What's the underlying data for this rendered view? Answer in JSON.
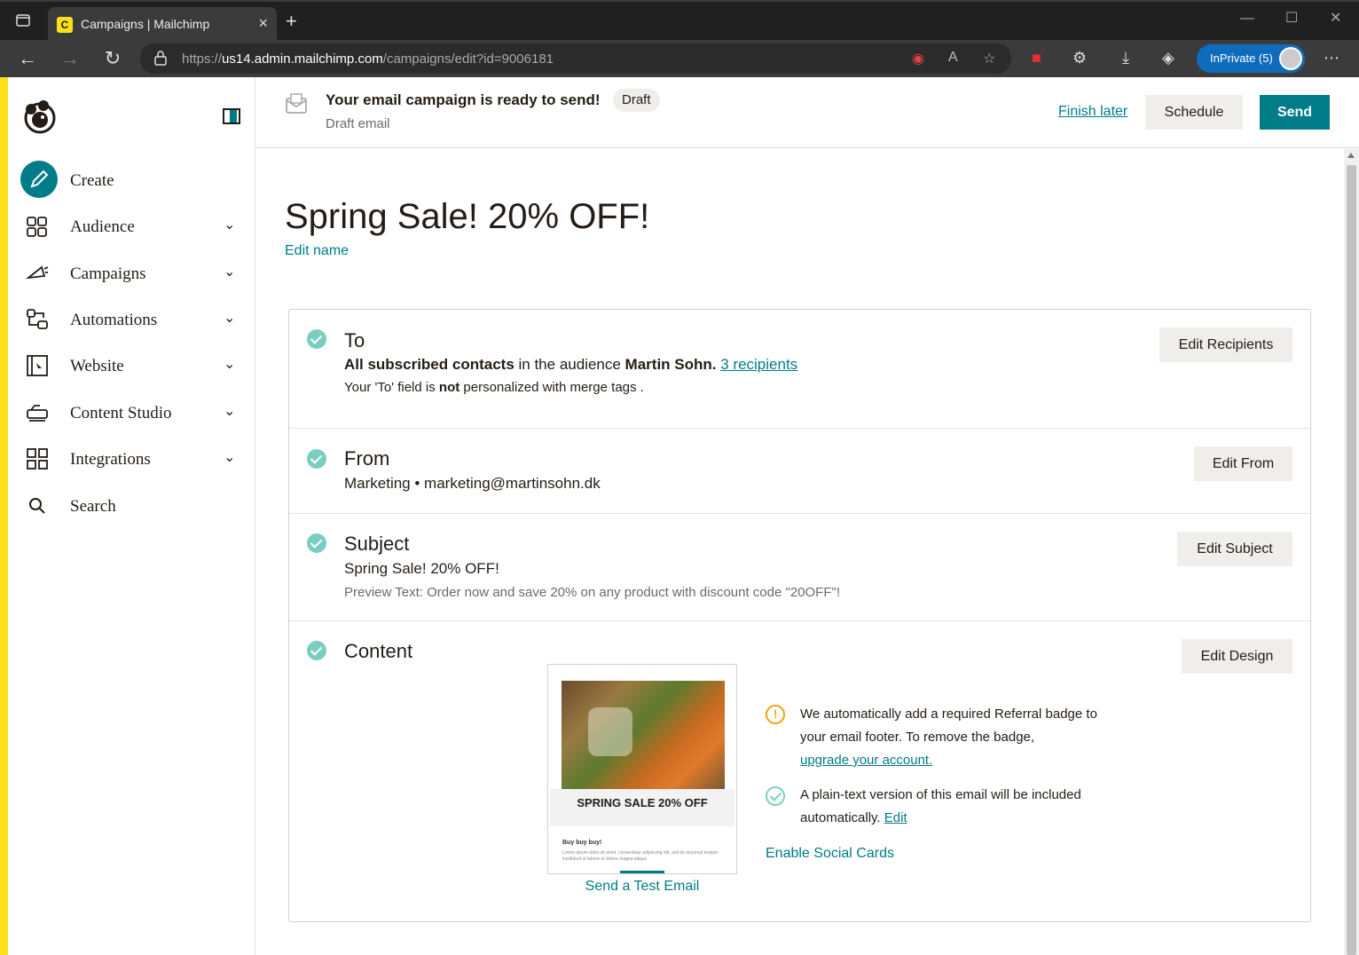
{
  "browser": {
    "tab_title": "Campaigns | Mailchimp",
    "url_prefix": "https://",
    "url_host": "us14.admin.mailchimp.com",
    "url_path": "/campaigns/edit?id=9006181",
    "inprivate_label": "InPrivate (5)"
  },
  "sidebar": {
    "items": [
      {
        "label": "Create"
      },
      {
        "label": "Audience"
      },
      {
        "label": "Campaigns"
      },
      {
        "label": "Automations"
      },
      {
        "label": "Website"
      },
      {
        "label": "Content Studio"
      },
      {
        "label": "Integrations"
      },
      {
        "label": "Search"
      }
    ]
  },
  "header": {
    "title": "Your email campaign is ready to send!",
    "badge": "Draft",
    "subtitle": "Draft email",
    "finish_later": "Finish later",
    "schedule": "Schedule",
    "send": "Send"
  },
  "campaign": {
    "name": "Spring Sale! 20% OFF!",
    "edit_name": "Edit name"
  },
  "to": {
    "title": "To",
    "line_bold": "All subscribed contacts",
    "line_mid": " in the audience ",
    "audience": "Martin Sohn.",
    "recipients": "3 recipients",
    "note_pre": "Your 'To' field is ",
    "note_bold": "not",
    "note_post": " personalized with merge tags .",
    "button": "Edit Recipients"
  },
  "from": {
    "title": "From",
    "line": "Marketing • marketing@martinsohn.dk",
    "button": "Edit From"
  },
  "subject": {
    "title": "Subject",
    "line": "Spring Sale! 20% OFF!",
    "preview": "Preview Text: Order now and save 20% on any product with discount code \"20OFF\"!",
    "button": "Edit Subject"
  },
  "content": {
    "title": "Content",
    "button": "Edit Design",
    "preview_heading": "SPRING SALE 20% OFF",
    "preview_body_title": "Buy buy buy!",
    "preview_body_text": "Lorem ipsum dolor sit amet, consectetur adipiscing elit, sed do eiusmod tempor incididunt ut labore et dolore magna aliqua.",
    "send_test": "Send a Test Email",
    "referral_line1": "We automatically add a required Referral badge to",
    "referral_line2": "your email footer. To remove the badge,",
    "referral_link": "upgrade your account.",
    "plaintext_line1": "A plain-text version of this email will be included",
    "plaintext_line2": "automatically.",
    "plaintext_edit": "Edit",
    "social_cards": "Enable Social Cards"
  },
  "colors": {
    "accent": "#007c89",
    "brand_yellow": "#ffe01b",
    "check": "#7ccdc1",
    "warning": "#f2a40c"
  }
}
